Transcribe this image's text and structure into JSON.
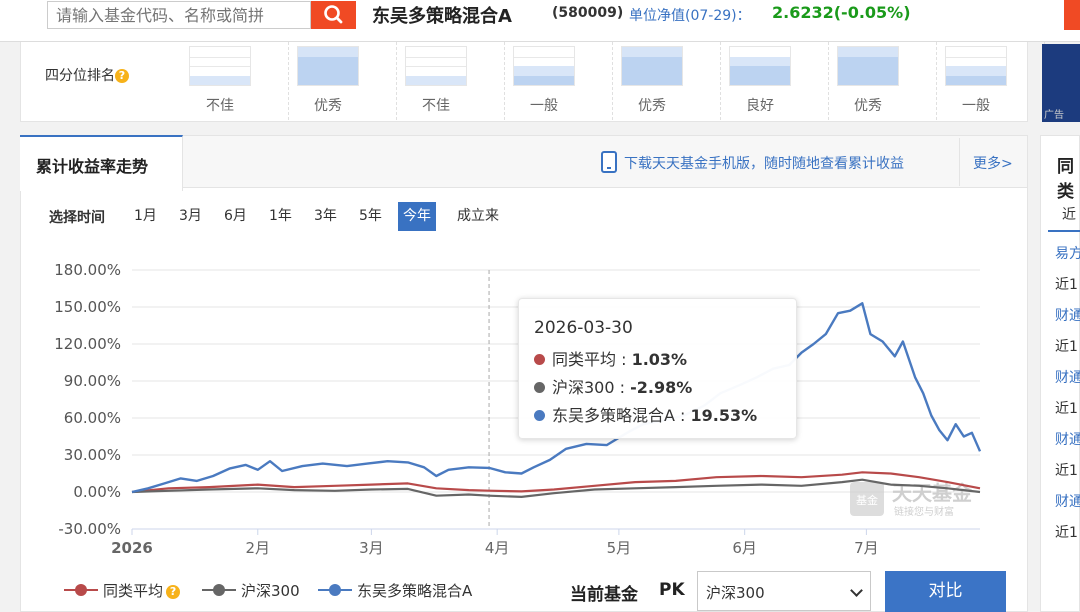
{
  "header": {
    "search_placeholder": "请输入基金代码、名称或简拼",
    "fund_name": "东吴多策略混合A",
    "fund_code": "(580009)",
    "nav_label": "单位净值(07-29)：",
    "nav_value": "2.6232(-0.05%)",
    "colors": {
      "accent": "#f04a24",
      "nav_up_down": "#1a9a1a"
    }
  },
  "quartile": {
    "label": "四分位排名",
    "help_icon": "?",
    "items": [
      {
        "label": "不佳",
        "level": 1
      },
      {
        "label": "优秀",
        "level": 4
      },
      {
        "label": "不佳",
        "level": 1
      },
      {
        "label": "一般",
        "level": 2
      },
      {
        "label": "优秀",
        "level": 4
      },
      {
        "label": "良好",
        "level": 3
      },
      {
        "label": "优秀",
        "level": 4
      },
      {
        "label": "一般",
        "level": 2
      }
    ]
  },
  "side": {
    "ad_label": "广告",
    "title": "同类",
    "tab": "近",
    "items": [
      "易方",
      "近1",
      "财通",
      "近1",
      "财通",
      "近1",
      "财通",
      "近1",
      "财通",
      "近1"
    ]
  },
  "chart_panel": {
    "tab_title": "累计收益率走势",
    "download_text": "下载天天基金手机版，随时随地查看累计收益",
    "more_text": "更多>",
    "time_label": "选择时间",
    "time_options": [
      "1月",
      "3月",
      "6月",
      "1年",
      "3年",
      "5年",
      "今年",
      "成立来"
    ],
    "active_time": "今年"
  },
  "tooltip": {
    "date": "2026-03-30",
    "rows": [
      {
        "name": "同类平均",
        "value": "1.03%",
        "color": "#b84a4a"
      },
      {
        "name": "沪深300",
        "value": "-2.98%",
        "color": "#666666"
      },
      {
        "name": "东吴多策略混合A",
        "value": "19.53%",
        "color": "#4a7ac0"
      }
    ]
  },
  "watermark": {
    "logo_text": "基金",
    "title": "天天基金",
    "subtitle": "链接您与财富"
  },
  "legend": [
    {
      "name": "同类平均",
      "color": "#b84a4a"
    },
    {
      "name": "沪深300",
      "color": "#666666"
    },
    {
      "name": "东吴多策略混合A",
      "color": "#4a7ac0"
    }
  ],
  "compare": {
    "current_label": "当前基金",
    "pk_label": "PK",
    "selected": "沪深300",
    "button_label": "对比"
  },
  "chart_data": {
    "type": "line",
    "ylim": [
      -30,
      180
    ],
    "yticks": [
      -30,
      0,
      30,
      60,
      90,
      120,
      150,
      180
    ],
    "ytick_labels": [
      "-30.00%",
      "0.00%",
      "30.00%",
      "60.00%",
      "90.00%",
      "120.00%",
      "150.00%",
      "180.00%"
    ],
    "xlim": [
      "2026-01-01",
      "2026-07-29"
    ],
    "xticks": [
      {
        "date": "2026-01-01",
        "label": "2026"
      },
      {
        "date": "2026-02-01",
        "label": "2月"
      },
      {
        "date": "2026-03-01",
        "label": "3月"
      },
      {
        "date": "2026-04-01",
        "label": "4月"
      },
      {
        "date": "2026-05-01",
        "label": "5月"
      },
      {
        "date": "2026-06-01",
        "label": "6月"
      },
      {
        "date": "2026-07-01",
        "label": "7月"
      }
    ],
    "crosshair_date": "2026-03-30",
    "grid": true,
    "series": [
      {
        "name": "东吴多策略混合A",
        "color": "#4a7ac0",
        "points": [
          [
            "2026-01-01",
            0
          ],
          [
            "2026-01-05",
            3
          ],
          [
            "2026-01-09",
            7
          ],
          [
            "2026-01-13",
            11
          ],
          [
            "2026-01-17",
            9
          ],
          [
            "2026-01-21",
            13
          ],
          [
            "2026-01-25",
            19
          ],
          [
            "2026-01-29",
            22
          ],
          [
            "2026-02-01",
            18
          ],
          [
            "2026-02-04",
            25
          ],
          [
            "2026-02-07",
            17
          ],
          [
            "2026-02-12",
            21
          ],
          [
            "2026-02-17",
            23
          ],
          [
            "2026-02-23",
            21
          ],
          [
            "2026-02-28",
            23
          ],
          [
            "2026-03-05",
            25
          ],
          [
            "2026-03-10",
            24
          ],
          [
            "2026-03-14",
            20
          ],
          [
            "2026-03-17",
            13
          ],
          [
            "2026-03-20",
            18
          ],
          [
            "2026-03-25",
            20
          ],
          [
            "2026-03-30",
            19.53
          ],
          [
            "2026-04-03",
            16
          ],
          [
            "2026-04-07",
            15
          ],
          [
            "2026-04-10",
            20
          ],
          [
            "2026-04-14",
            26
          ],
          [
            "2026-04-18",
            35
          ],
          [
            "2026-04-23",
            39
          ],
          [
            "2026-04-28",
            38
          ],
          [
            "2026-05-03",
            48
          ],
          [
            "2026-05-07",
            55
          ],
          [
            "2026-05-12",
            58
          ],
          [
            "2026-05-17",
            62
          ],
          [
            "2026-05-22",
            70
          ],
          [
            "2026-05-26",
            80
          ],
          [
            "2026-05-31",
            87
          ],
          [
            "2026-06-04",
            93
          ],
          [
            "2026-06-08",
            100
          ],
          [
            "2026-06-12",
            103
          ],
          [
            "2026-06-15",
            113
          ],
          [
            "2026-06-18",
            120
          ],
          [
            "2026-06-21",
            128
          ],
          [
            "2026-06-24",
            145
          ],
          [
            "2026-06-27",
            147
          ],
          [
            "2026-06-30",
            153
          ],
          [
            "2026-07-02",
            128
          ],
          [
            "2026-07-05",
            122
          ],
          [
            "2026-07-08",
            110
          ],
          [
            "2026-07-10",
            122
          ],
          [
            "2026-07-13",
            93
          ],
          [
            "2026-07-15",
            80
          ],
          [
            "2026-07-17",
            62
          ],
          [
            "2026-07-19",
            50
          ],
          [
            "2026-07-21",
            42
          ],
          [
            "2026-07-23",
            55
          ],
          [
            "2026-07-25",
            45
          ],
          [
            "2026-07-27",
            48
          ],
          [
            "2026-07-29",
            33
          ]
        ]
      },
      {
        "name": "同类平均",
        "color": "#b84a4a",
        "points": [
          [
            "2026-01-01",
            0
          ],
          [
            "2026-01-10",
            3
          ],
          [
            "2026-01-20",
            4
          ],
          [
            "2026-02-01",
            6
          ],
          [
            "2026-02-10",
            4
          ],
          [
            "2026-02-20",
            5
          ],
          [
            "2026-03-01",
            6
          ],
          [
            "2026-03-10",
            7
          ],
          [
            "2026-03-17",
            3
          ],
          [
            "2026-03-25",
            1.5
          ],
          [
            "2026-03-30",
            1.03
          ],
          [
            "2026-04-07",
            0.5
          ],
          [
            "2026-04-15",
            2
          ],
          [
            "2026-04-25",
            5
          ],
          [
            "2026-05-05",
            8
          ],
          [
            "2026-05-15",
            9
          ],
          [
            "2026-05-25",
            12
          ],
          [
            "2026-06-05",
            13
          ],
          [
            "2026-06-15",
            12
          ],
          [
            "2026-06-25",
            14
          ],
          [
            "2026-06-30",
            16
          ],
          [
            "2026-07-07",
            15
          ],
          [
            "2026-07-14",
            12
          ],
          [
            "2026-07-21",
            8
          ],
          [
            "2026-07-29",
            3
          ]
        ]
      },
      {
        "name": "沪深300",
        "color": "#666666",
        "points": [
          [
            "2026-01-01",
            0
          ],
          [
            "2026-01-10",
            1
          ],
          [
            "2026-01-20",
            2
          ],
          [
            "2026-02-01",
            3
          ],
          [
            "2026-02-10",
            1.5
          ],
          [
            "2026-02-20",
            1
          ],
          [
            "2026-03-01",
            2
          ],
          [
            "2026-03-10",
            2.5
          ],
          [
            "2026-03-17",
            -3
          ],
          [
            "2026-03-25",
            -2
          ],
          [
            "2026-03-30",
            -2.98
          ],
          [
            "2026-04-07",
            -4
          ],
          [
            "2026-04-15",
            -1
          ],
          [
            "2026-04-25",
            2
          ],
          [
            "2026-05-05",
            3
          ],
          [
            "2026-05-15",
            4
          ],
          [
            "2026-05-25",
            5
          ],
          [
            "2026-06-05",
            6
          ],
          [
            "2026-06-15",
            5
          ],
          [
            "2026-06-25",
            8
          ],
          [
            "2026-06-30",
            10
          ],
          [
            "2026-07-07",
            6
          ],
          [
            "2026-07-14",
            5
          ],
          [
            "2026-07-21",
            3
          ],
          [
            "2026-07-29",
            0
          ]
        ]
      }
    ]
  }
}
